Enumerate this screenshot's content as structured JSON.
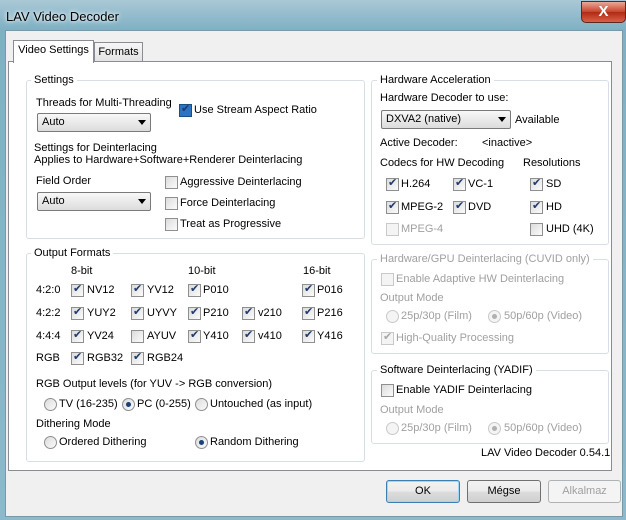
{
  "window": {
    "title": "LAV Video Decoder",
    "close_glyph": "X"
  },
  "tabs": [
    {
      "label": "Video Settings",
      "active": true
    },
    {
      "label": "Formats",
      "active": false
    }
  ],
  "settings": {
    "group_title": "Settings",
    "threads_label": "Threads for Multi-Threading",
    "threads_value": "Auto",
    "stream_aspect_label": "Use Stream Aspect Ratio",
    "stream_aspect_checked": true,
    "deint_title": "Settings for Deinterlacing",
    "deint_subtitle": "Applies to Hardware+Software+Renderer Deinterlacing",
    "field_order_label": "Field Order",
    "field_order_value": "Auto",
    "aggressive_label": "Aggressive Deinterlacing",
    "force_label": "Force Deinterlacing",
    "progressive_label": "Treat as Progressive"
  },
  "output": {
    "group_title": "Output Formats",
    "col_8bit": "8-bit",
    "col_10bit": "10-bit",
    "col_16bit": "16-bit",
    "rows": [
      {
        "label": "4:2:0",
        "formats": [
          {
            "name": "NV12",
            "on": true
          },
          {
            "name": "YV12",
            "on": true
          },
          {
            "name": "P010",
            "on": true
          },
          {
            "name": "P016",
            "on": true
          }
        ]
      },
      {
        "label": "4:2:2",
        "formats": [
          {
            "name": "YUY2",
            "on": true
          },
          {
            "name": "UYVY",
            "on": true
          },
          {
            "name": "P210",
            "on": true
          },
          {
            "name": "v210",
            "on": true
          },
          {
            "name": "P216",
            "on": true
          }
        ]
      },
      {
        "label": "4:4:4",
        "formats": [
          {
            "name": "YV24",
            "on": true
          },
          {
            "name": "AYUV",
            "on": false
          },
          {
            "name": "Y410",
            "on": true
          },
          {
            "name": "v410",
            "on": true
          },
          {
            "name": "Y416",
            "on": true
          }
        ]
      },
      {
        "label": "RGB",
        "formats": [
          {
            "name": "RGB32",
            "on": true
          },
          {
            "name": "RGB24",
            "on": true
          }
        ]
      }
    ],
    "levels_label": "RGB Output levels (for YUV -> RGB conversion)",
    "levels": [
      {
        "label": "TV (16-235)",
        "on": false
      },
      {
        "label": "PC (0-255)",
        "on": true
      },
      {
        "label": "Untouched (as input)",
        "on": false
      }
    ],
    "dither_label": "Dithering Mode",
    "dither": [
      {
        "label": "Ordered Dithering",
        "on": false
      },
      {
        "label": "Random Dithering",
        "on": true
      }
    ]
  },
  "hwaccel": {
    "group_title": "Hardware Acceleration",
    "decoder_label": "Hardware Decoder to use:",
    "decoder_value": "DXVA2 (native)",
    "available": "Available",
    "active_label": "Active Decoder:",
    "active_value": "<inactive>",
    "codecs_label": "Codecs for HW Decoding",
    "resolutions_label": "Resolutions",
    "codecs": [
      {
        "name": "H.264",
        "on": true
      },
      {
        "name": "VC-1",
        "on": true
      },
      {
        "name": "MPEG-2",
        "on": true
      },
      {
        "name": "DVD",
        "on": true
      },
      {
        "name": "MPEG-4",
        "on": false,
        "disabled": true
      }
    ],
    "resolutions": [
      {
        "name": "SD",
        "on": true
      },
      {
        "name": "HD",
        "on": true
      },
      {
        "name": "UHD (4K)",
        "on": false
      }
    ]
  },
  "cuvid": {
    "group_title": "Hardware/GPU Deinterlacing (CUVID only)",
    "adaptive_label": "Enable Adaptive HW Deinterlacing",
    "mode_label": "Output Mode",
    "film_label": "25p/30p (Film)",
    "video_label": "50p/60p (Video)",
    "hq_label": "High-Quality Processing"
  },
  "yadif": {
    "group_title": "Software Deinterlacing (YADIF)",
    "enable_label": "Enable YADIF Deinterlacing",
    "mode_label": "Output Mode",
    "film_label": "25p/30p (Film)",
    "video_label": "50p/60p (Video)"
  },
  "version": "LAV Video Decoder 0.54.1",
  "buttons": {
    "ok": "OK",
    "cancel": "Mégse",
    "apply": "Alkalmaz"
  },
  "colors": {
    "accent_checkbox": "#2a74c2",
    "close_button": "#c8432a"
  }
}
